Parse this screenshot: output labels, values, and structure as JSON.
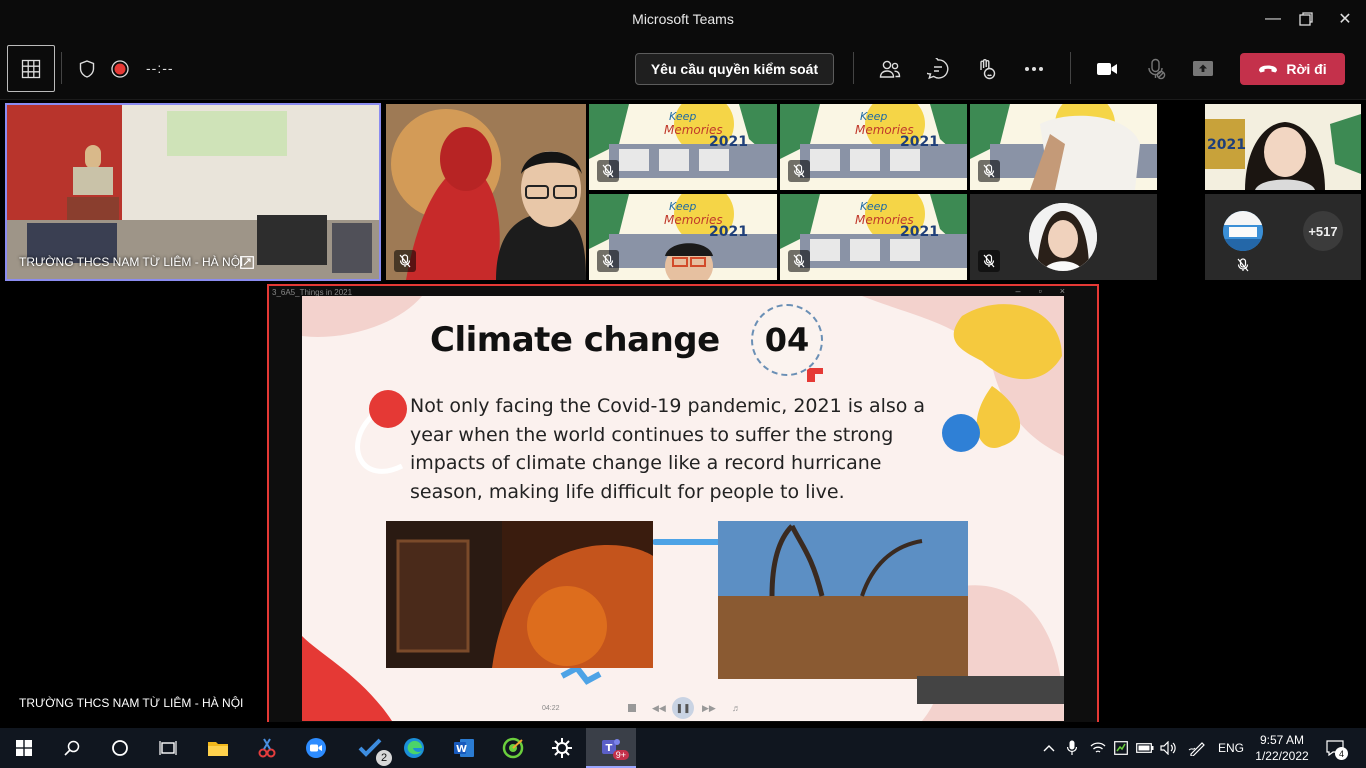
{
  "window": {
    "title": "Microsoft Teams"
  },
  "toolbar": {
    "timer": "--:--",
    "request_control_label": "Yêu cầu quyền kiểm soát",
    "leave_label": "Rời đi"
  },
  "participants": {
    "featured_name": "TRƯỜNG THCS NAM TỪ LIÊM - HÀ NỘI",
    "overflow_count": "+517",
    "keep_memories_text": "Keep the Memories 2021"
  },
  "share": {
    "presenter_name": "TRƯỜNG THCS NAM TỪ LIÊM - HÀ NỘI",
    "player_title": "3_6A5_Things in 2021",
    "player_time": "04:22",
    "slide": {
      "title": "Climate change",
      "number": "04",
      "body": "Not only facing the Covid-19 pandemic, 2021 is also a year when the world continues to suffer the strong impacts of climate change like a record hurricane season, making life difficult for people to live."
    }
  },
  "taskbar": {
    "todo_badge": "2",
    "teams_badge": "9+",
    "language": "ENG",
    "time": "9:57 AM",
    "date": "1/22/2022",
    "notifications_count": "4"
  },
  "colors": {
    "leave": "#c4314b",
    "accent": "#8b8cf0",
    "share_border": "#e53935"
  }
}
